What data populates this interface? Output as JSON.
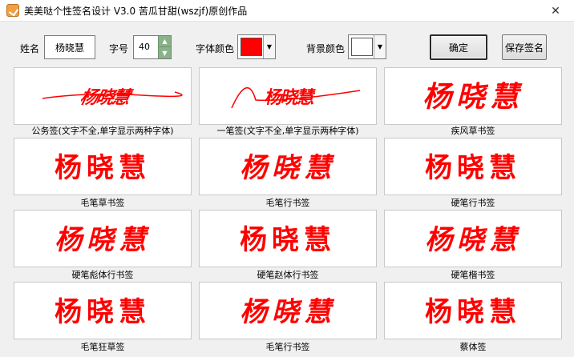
{
  "window": {
    "title": "美美哒个性签名设计 V3.0     苦瓜甘甜(wszjf)原创作品",
    "close_label": "✕"
  },
  "toolbar": {
    "name_label": "姓名",
    "name_value": "杨晓慧",
    "size_label": "字号",
    "size_value": "40",
    "font_color_label": "字体颜色",
    "font_color": "#ff0000",
    "bg_color_label": "背景颜色",
    "bg_color": "#ffffff",
    "confirm_label": "确定",
    "save_label": "保存签名"
  },
  "signature_color": "#ff0000",
  "signatures": [
    {
      "text": "杨晓慧",
      "caption": "公务签(文字不全,单字显示两种字体)"
    },
    {
      "text": "杨晓慧",
      "caption": "一笔签(文字不全,单字显示两种字体)"
    },
    {
      "text": "杨晓慧",
      "caption": "疾风草书签"
    },
    {
      "text": "杨晓慧",
      "caption": "毛笔草书签"
    },
    {
      "text": "杨晓慧",
      "caption": "毛笔行书签"
    },
    {
      "text": "杨晓慧",
      "caption": "硬笔行书签"
    },
    {
      "text": "杨晓慧",
      "caption": "硬笔彪体行书签"
    },
    {
      "text": "杨晓慧",
      "caption": "硬笔赵体行书签"
    },
    {
      "text": "杨晓慧",
      "caption": "硬笔楷书签"
    },
    {
      "text": "杨晓慧",
      "caption": "毛笔狂草签"
    },
    {
      "text": "杨晓慧",
      "caption": "毛笔行书签"
    },
    {
      "text": "杨晓慧",
      "caption": "蔡体签"
    }
  ]
}
